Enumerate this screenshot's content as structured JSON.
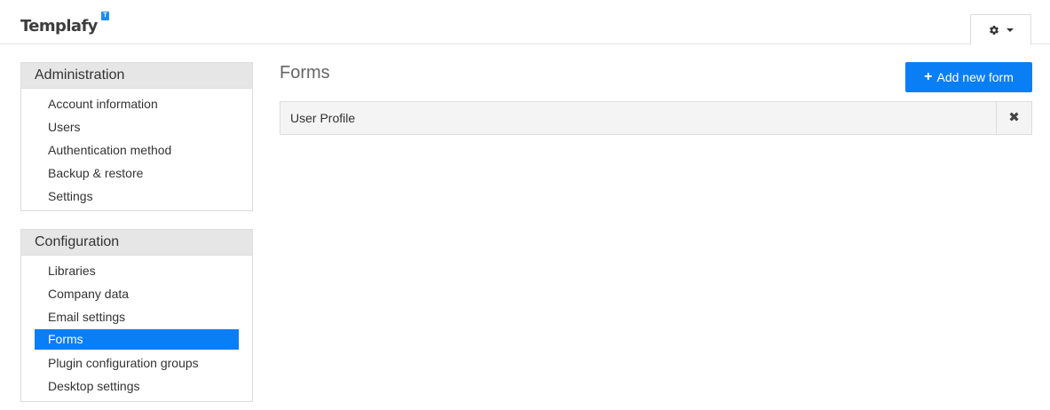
{
  "header": {
    "logo_text": "Templafy",
    "logo_badge": "T",
    "settings_icon": "gear-icon",
    "settings_caret_icon": "chevron-down-icon"
  },
  "sidebar": {
    "administration": {
      "title": "Administration",
      "items": [
        {
          "label": "Account information"
        },
        {
          "label": "Users"
        },
        {
          "label": "Authentication method"
        },
        {
          "label": "Backup & restore"
        },
        {
          "label": "Settings"
        }
      ]
    },
    "configuration": {
      "title": "Configuration",
      "items": [
        {
          "label": "Libraries"
        },
        {
          "label": "Company data"
        },
        {
          "label": "Email settings"
        },
        {
          "label": "Forms",
          "active": true
        },
        {
          "label": "Plugin configuration groups"
        },
        {
          "label": "Desktop settings"
        }
      ]
    }
  },
  "main": {
    "title": "Forms",
    "add_button_label": "Add new form",
    "add_button_icon": "plus-icon",
    "forms": [
      {
        "name": "User Profile",
        "delete_icon": "close-icon"
      }
    ]
  },
  "colors": {
    "accent": "#0a7ef5",
    "panel_header_bg": "#e6e6e6",
    "row_bg": "#f4f4f4"
  }
}
